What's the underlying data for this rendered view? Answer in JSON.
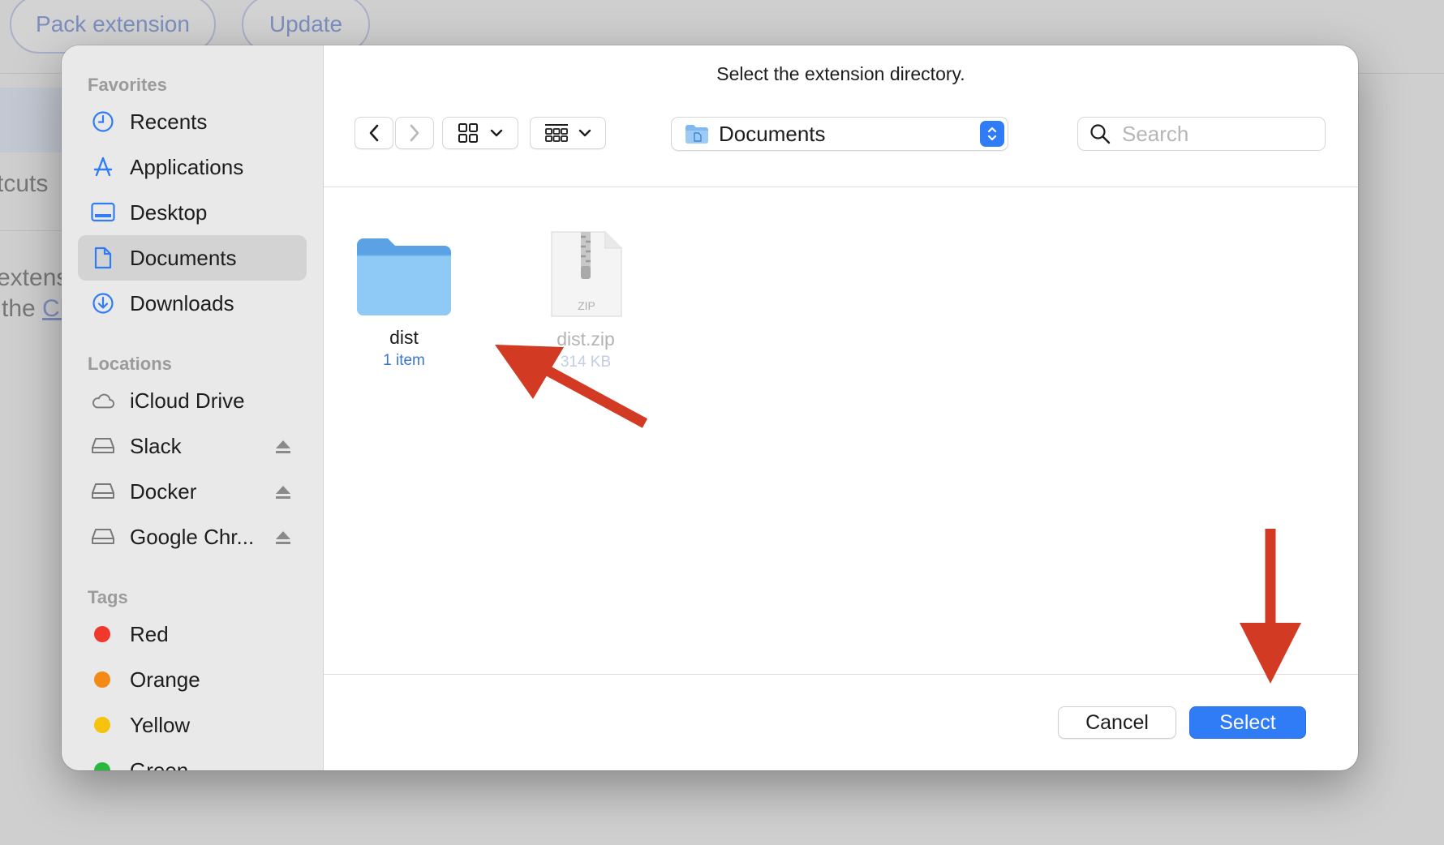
{
  "background": {
    "toolbar_buttons": [
      "Pack extension",
      "Update"
    ],
    "text_shortcuts": "tcuts",
    "text_extens": "extens",
    "text_the": "the ",
    "text_link": "Cl"
  },
  "dialog": {
    "title": "Select the extension directory."
  },
  "sidebar": {
    "favorites_heading": "Favorites",
    "favorites": [
      {
        "label": "Recents",
        "icon": "clock-icon"
      },
      {
        "label": "Applications",
        "icon": "applications-icon"
      },
      {
        "label": "Desktop",
        "icon": "desktop-icon"
      },
      {
        "label": "Documents",
        "icon": "document-icon",
        "selected": true
      },
      {
        "label": "Downloads",
        "icon": "download-icon"
      }
    ],
    "locations_heading": "Locations",
    "locations": [
      {
        "label": "iCloud Drive",
        "icon": "cloud-icon"
      },
      {
        "label": "Slack",
        "icon": "drive-icon",
        "eject": true
      },
      {
        "label": "Docker",
        "icon": "drive-icon",
        "eject": true
      },
      {
        "label": "Google Chr...",
        "icon": "drive-icon",
        "eject": true
      }
    ],
    "tags_heading": "Tags",
    "tags": [
      {
        "label": "Red",
        "color": "#f0382c"
      },
      {
        "label": "Orange",
        "color": "#f48a15"
      },
      {
        "label": "Yellow",
        "color": "#f5c20c"
      },
      {
        "label": "Green",
        "color": "#28b840"
      }
    ]
  },
  "toolbar": {
    "path_folder": "Documents",
    "search_placeholder": "Search"
  },
  "files": [
    {
      "name": "dist",
      "meta": "1 item",
      "type": "folder",
      "enabled": true
    },
    {
      "name": "dist.zip",
      "meta": "314 KB",
      "type": "zip",
      "enabled": false,
      "icon_label": "ZIP"
    }
  ],
  "buttons": {
    "cancel": "Cancel",
    "select": "Select"
  },
  "colors": {
    "accent": "#2f7cf6",
    "annotation_arrow": "#d23a24"
  }
}
